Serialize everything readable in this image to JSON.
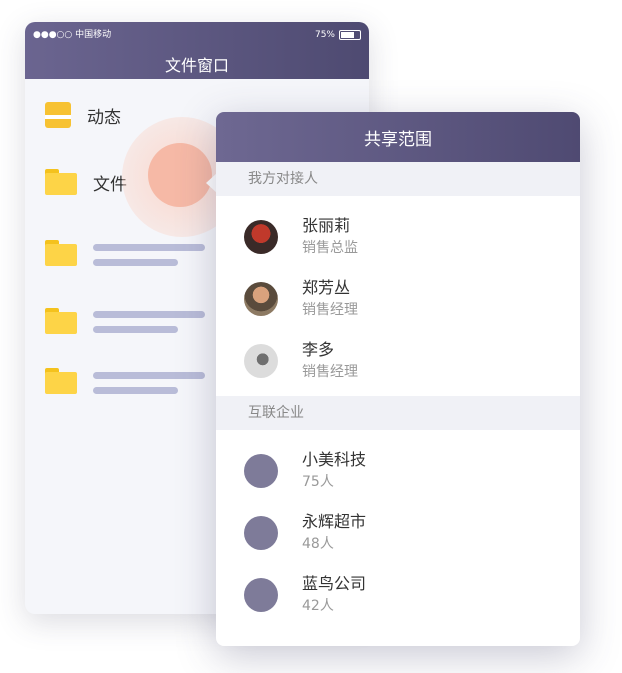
{
  "phone": {
    "status": {
      "carrier": "●●●○○ 中国移动",
      "battery": "75%"
    },
    "title": "文件窗口",
    "menu": [
      {
        "label": "动态",
        "icon": "dynamic-icon"
      },
      {
        "label": "文件",
        "icon": "folder-icon"
      }
    ]
  },
  "popup": {
    "title": "共享范围",
    "our_contacts_label": "我方对接人",
    "contacts": [
      {
        "name": "张丽莉",
        "role": "销售总监"
      },
      {
        "name": "郑芳丛",
        "role": "销售经理"
      },
      {
        "name": "李多",
        "role": "销售经理"
      }
    ],
    "companies_label": "互联企业",
    "companies": [
      {
        "name": "小美科技",
        "count": "75人"
      },
      {
        "name": "永辉超市",
        "count": "48人"
      },
      {
        "name": "蓝鸟公司",
        "count": "42人"
      }
    ]
  },
  "colors": {
    "header": "#5a557c",
    "folder": "#fdd447",
    "bar": "#b9bcd8",
    "company_dot": "#7e7b99"
  }
}
